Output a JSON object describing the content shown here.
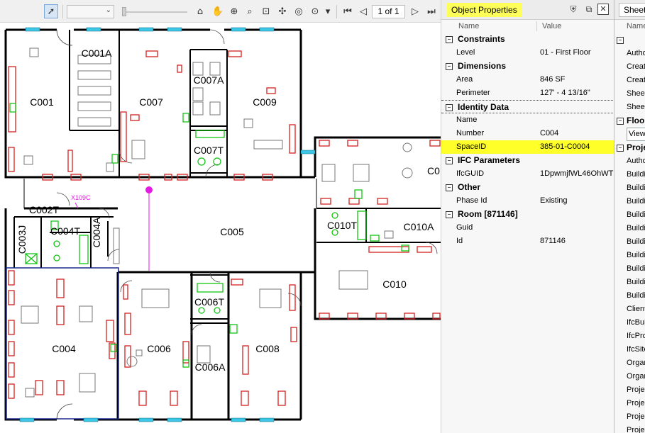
{
  "toolbar": {
    "page_indicator": "1 of 1"
  },
  "floor_plan": {
    "rooms": [
      {
        "id": "C001",
        "label": "C001"
      },
      {
        "id": "C001A",
        "label": "C001A"
      },
      {
        "id": "C007",
        "label": "C007"
      },
      {
        "id": "C007A",
        "label": "C007A"
      },
      {
        "id": "C007T",
        "label": "C007T"
      },
      {
        "id": "C009",
        "label": "C009"
      },
      {
        "id": "C0",
        "label": "C0"
      },
      {
        "id": "C002T",
        "label": "C002T"
      },
      {
        "id": "C003J",
        "label": "C003J"
      },
      {
        "id": "C004T",
        "label": "C004T"
      },
      {
        "id": "C004A",
        "label": "C004A"
      },
      {
        "id": "C005",
        "label": "C005"
      },
      {
        "id": "C010T",
        "label": "C010T"
      },
      {
        "id": "C010A",
        "label": "C010A"
      },
      {
        "id": "C010",
        "label": "C010"
      },
      {
        "id": "C004",
        "label": "C004"
      },
      {
        "id": "C006",
        "label": "C006"
      },
      {
        "id": "C006T",
        "label": "C006T"
      },
      {
        "id": "C006A",
        "label": "C006A"
      },
      {
        "id": "C008",
        "label": "C008"
      }
    ],
    "tag": "X109C"
  },
  "properties": {
    "title": "Object Properties",
    "col_name": "Name",
    "col_value": "Value",
    "sections": [
      {
        "name": "Constraints",
        "rows": [
          {
            "k": "Level",
            "v": "01 - First Floor"
          }
        ]
      },
      {
        "name": "Dimensions",
        "rows": [
          {
            "k": "Area",
            "v": "846 SF"
          },
          {
            "k": "Perimeter",
            "v": "127' - 4 13/16\""
          }
        ]
      },
      {
        "name": "Identity Data",
        "rows": [
          {
            "k": "Name",
            "v": ""
          },
          {
            "k": "Number",
            "v": "C004"
          },
          {
            "k": "SpaceID",
            "v": "385-01-C0004"
          }
        ]
      },
      {
        "name": "IFC Parameters",
        "rows": [
          {
            "k": "IfcGUID",
            "v": "1DpwmjfWL46OhWT"
          }
        ]
      },
      {
        "name": "Other",
        "rows": [
          {
            "k": "Phase Id",
            "v": "Existing"
          }
        ]
      },
      {
        "name": "Room [871146]",
        "rows": [
          {
            "k": "Guid",
            "v": ""
          },
          {
            "k": "Id",
            "v": "871146"
          }
        ]
      }
    ]
  },
  "sheet": {
    "tab": "Sheet",
    "col_name": "Name",
    "rows": [
      {
        "type": "cat",
        "t": ""
      },
      {
        "type": "item",
        "t": "Autho"
      },
      {
        "type": "item",
        "t": "Create"
      },
      {
        "type": "item",
        "t": "Create"
      },
      {
        "type": "item",
        "t": "Sheet"
      },
      {
        "type": "item",
        "t": "Sheet"
      },
      {
        "type": "cat",
        "t": "Floo"
      },
      {
        "type": "sel",
        "t": "View"
      },
      {
        "type": "cat",
        "t": "Proje"
      },
      {
        "type": "item",
        "t": "Autho"
      },
      {
        "type": "item",
        "t": "Buildi"
      },
      {
        "type": "item",
        "t": "Buildi"
      },
      {
        "type": "item",
        "t": "Buildi"
      },
      {
        "type": "item",
        "t": "Buildi"
      },
      {
        "type": "item",
        "t": "Buildi"
      },
      {
        "type": "item",
        "t": "Buildi"
      },
      {
        "type": "item",
        "t": "Buildi"
      },
      {
        "type": "item",
        "t": "Buildi"
      },
      {
        "type": "item",
        "t": "Buildi"
      },
      {
        "type": "item",
        "t": "Buildi"
      },
      {
        "type": "item",
        "t": "Client"
      },
      {
        "type": "item",
        "t": "IfcBui"
      },
      {
        "type": "item",
        "t": "IfcProj"
      },
      {
        "type": "item",
        "t": "IfcSite"
      },
      {
        "type": "item",
        "t": "Organ"
      },
      {
        "type": "item",
        "t": "Organ"
      },
      {
        "type": "item",
        "t": "Projec"
      },
      {
        "type": "item",
        "t": "Projec"
      },
      {
        "type": "item",
        "t": "Projec"
      },
      {
        "type": "item",
        "t": "Projec"
      }
    ]
  },
  "colors": {
    "highlight": "#ffff2a",
    "furniture": "#d42020",
    "fixtures": "#12c512",
    "selected_outline": "#1c2a8c",
    "tag": "#e21ae2"
  }
}
